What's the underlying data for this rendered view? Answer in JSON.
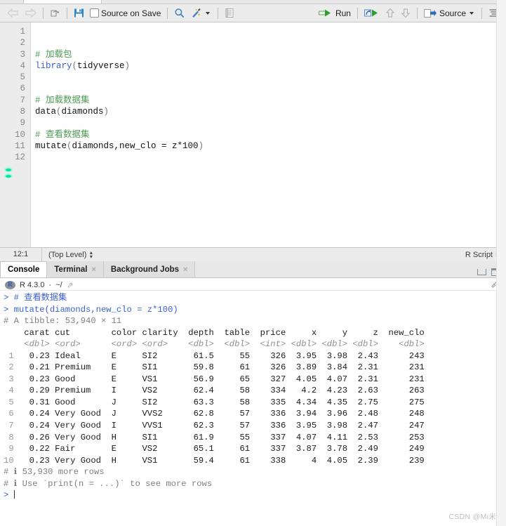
{
  "editor_toolbar": {
    "back_icon": "back-arrow-icon",
    "forward_icon": "forward-arrow-icon",
    "popout_icon": "show-in-new-window-icon",
    "save_icon": "save-icon",
    "source_on_save_label": "Source on Save",
    "find_icon": "search-magnifier-icon",
    "magic_icon": "code-tools-wand-icon",
    "magic_caret_icon": "chevron-down-icon",
    "compile_icon": "compile-report-icon",
    "run_label": "Run",
    "run_icon": "run-arrow-icon",
    "rerun_icon": "rerun-icon",
    "prev_chunk_icon": "up-arrow-icon",
    "next_chunk_icon": "down-arrow-icon",
    "source_label": "Source",
    "source_icon": "source-icon",
    "source_caret_icon": "chevron-down-icon",
    "outline_icon": "document-outline-icon"
  },
  "editor": {
    "line_numbers": [
      "1",
      "2",
      "3",
      "4",
      "5",
      "6",
      "7",
      "8",
      "9",
      "10",
      "11",
      "12"
    ],
    "lines": [
      {
        "n": 1,
        "segments": []
      },
      {
        "n": 2,
        "segments": []
      },
      {
        "n": 3,
        "segments": [
          {
            "t": "# 加载包",
            "c": "cmt"
          }
        ]
      },
      {
        "n": 4,
        "segments": [
          {
            "t": "library",
            "c": "fn"
          },
          {
            "t": "(",
            "c": "pn"
          },
          {
            "t": "tidyverse",
            "c": "txt"
          },
          {
            "t": ")",
            "c": "pn"
          }
        ]
      },
      {
        "n": 5,
        "segments": []
      },
      {
        "n": 6,
        "segments": []
      },
      {
        "n": 7,
        "segments": [
          {
            "t": "# 加载数据集",
            "c": "cmt"
          }
        ]
      },
      {
        "n": 8,
        "segments": [
          {
            "t": "data",
            "c": "txt"
          },
          {
            "t": "(",
            "c": "pn"
          },
          {
            "t": "diamonds",
            "c": "txt"
          },
          {
            "t": ")",
            "c": "pn"
          }
        ]
      },
      {
        "n": 9,
        "segments": []
      },
      {
        "n": 10,
        "segments": [
          {
            "t": "# 查看数据集",
            "c": "cmt"
          }
        ]
      },
      {
        "n": 11,
        "segments": [
          {
            "t": "mutate",
            "c": "txt"
          },
          {
            "t": "(",
            "c": "pn"
          },
          {
            "t": "diamonds,new_clo = z*100",
            "c": "txt"
          },
          {
            "t": ")",
            "c": "pn"
          }
        ]
      },
      {
        "n": 12,
        "segments": []
      }
    ]
  },
  "editor_status": {
    "cursor_position": "12:1",
    "scope": "(Top Level)",
    "file_type": "R Script"
  },
  "console_tabs": {
    "items": [
      {
        "label": "Console",
        "closable": false,
        "active": true
      },
      {
        "label": "Terminal",
        "closable": true,
        "active": false
      },
      {
        "label": "Background Jobs",
        "closable": true,
        "active": false
      }
    ],
    "minimize_icon": "minimize-icon",
    "maximize_icon": "maximize-icon"
  },
  "console_header": {
    "r_logo": "r-logo-icon",
    "version": "R 4.3.0",
    "separator": "·",
    "working_dir": "~/",
    "open_dir_icon": "open-directory-arrow-icon",
    "clear_icon": "clear-console-broom-icon"
  },
  "console_output": {
    "prompt": ">",
    "lines": [
      {
        "type": "input",
        "prompt": ">",
        "text": "# 查看数据集"
      },
      {
        "type": "input",
        "prompt": ">",
        "text": "mutate(diamonds,new_clo = z*100)"
      },
      {
        "type": "meta",
        "text": "# A tibble: 53,940 × 11"
      }
    ],
    "tibble_summary": "# A tibble: 53,940 × 11",
    "footer": [
      "# ℹ 53,930 more rows",
      "# ℹ Use `print(n = ...)` to see more rows"
    ]
  },
  "table": {
    "index_header": "",
    "columns": [
      "carat",
      "cut",
      "color",
      "clarity",
      "depth",
      "table",
      "price",
      "x",
      "y",
      "z",
      "new_clo"
    ],
    "types": [
      "<dbl>",
      "<ord>",
      "<ord>",
      "<ord>",
      "<dbl>",
      "<dbl>",
      "<int>",
      "<dbl>",
      "<dbl>",
      "<dbl>",
      "<dbl>"
    ],
    "rows": [
      {
        "i": "1",
        "carat": "0.23",
        "cut": "Ideal",
        "color": "E",
        "clarity": "SI2",
        "depth": "61.5",
        "table": "55",
        "price": "326",
        "x": "3.95",
        "y": "3.98",
        "z": "2.43",
        "new_clo": "243"
      },
      {
        "i": "2",
        "carat": "0.21",
        "cut": "Premium",
        "color": "E",
        "clarity": "SI1",
        "depth": "59.8",
        "table": "61",
        "price": "326",
        "x": "3.89",
        "y": "3.84",
        "z": "2.31",
        "new_clo": "231"
      },
      {
        "i": "3",
        "carat": "0.23",
        "cut": "Good",
        "color": "E",
        "clarity": "VS1",
        "depth": "56.9",
        "table": "65",
        "price": "327",
        "x": "4.05",
        "y": "4.07",
        "z": "2.31",
        "new_clo": "231"
      },
      {
        "i": "4",
        "carat": "0.29",
        "cut": "Premium",
        "color": "I",
        "clarity": "VS2",
        "depth": "62.4",
        "table": "58",
        "price": "334",
        "x": "4.2",
        "y": "4.23",
        "z": "2.63",
        "new_clo": "263"
      },
      {
        "i": "5",
        "carat": "0.31",
        "cut": "Good",
        "color": "J",
        "clarity": "SI2",
        "depth": "63.3",
        "table": "58",
        "price": "335",
        "x": "4.34",
        "y": "4.35",
        "z": "2.75",
        "new_clo": "275"
      },
      {
        "i": "6",
        "carat": "0.24",
        "cut": "Very Good",
        "color": "J",
        "clarity": "VVS2",
        "depth": "62.8",
        "table": "57",
        "price": "336",
        "x": "3.94",
        "y": "3.96",
        "z": "2.48",
        "new_clo": "248"
      },
      {
        "i": "7",
        "carat": "0.24",
        "cut": "Very Good",
        "color": "I",
        "clarity": "VVS1",
        "depth": "62.3",
        "table": "57",
        "price": "336",
        "x": "3.95",
        "y": "3.98",
        "z": "2.47",
        "new_clo": "247"
      },
      {
        "i": "8",
        "carat": "0.26",
        "cut": "Very Good",
        "color": "H",
        "clarity": "SI1",
        "depth": "61.9",
        "table": "55",
        "price": "337",
        "x": "4.07",
        "y": "4.11",
        "z": "2.53",
        "new_clo": "253"
      },
      {
        "i": "9",
        "carat": "0.22",
        "cut": "Fair",
        "color": "E",
        "clarity": "VS2",
        "depth": "65.1",
        "table": "61",
        "price": "337",
        "x": "3.87",
        "y": "3.78",
        "z": "2.49",
        "new_clo": "249"
      },
      {
        "i": "10",
        "carat": "0.23",
        "cut": "Very Good",
        "color": "H",
        "clarity": "VS1",
        "depth": "59.4",
        "table": "61",
        "price": "338",
        "x": "4",
        "y": "4.05",
        "z": "2.39",
        "new_clo": "239"
      }
    ]
  },
  "watermark": "CSDN @Mi米",
  "colors": {
    "comment_green": "#4c9a52",
    "function_blue": "#3a5fcd",
    "prompt_blue": "#3a5fcd",
    "meta_gray": "#808080",
    "toolbar_bg": "#ececec",
    "accent_green": "#00a651"
  }
}
